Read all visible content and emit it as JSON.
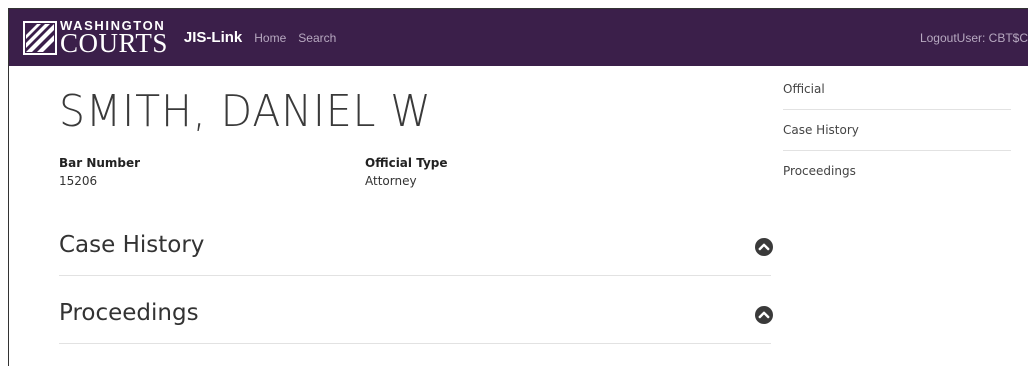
{
  "navbar": {
    "brand_top": "WASHINGTON",
    "brand_bottom": "COURTS",
    "app_name": "JIS-Link",
    "links": [
      "Home",
      "Search"
    ],
    "logout_label": "Logout",
    "user_label": "User: CBT$C",
    "background": "#3b1f4a"
  },
  "official": {
    "name": "SMITH, DANIEL W",
    "bar_number_label": "Bar Number",
    "bar_number_value": "15206",
    "official_type_label": "Official Type",
    "official_type_value": "Attorney"
  },
  "sections": [
    {
      "title": "Case History",
      "icon": "chevron-up-circle-icon"
    },
    {
      "title": "Proceedings",
      "icon": "chevron-up-circle-icon"
    }
  ],
  "sidebar": {
    "items": [
      "Official",
      "Case History",
      "Proceedings"
    ]
  }
}
